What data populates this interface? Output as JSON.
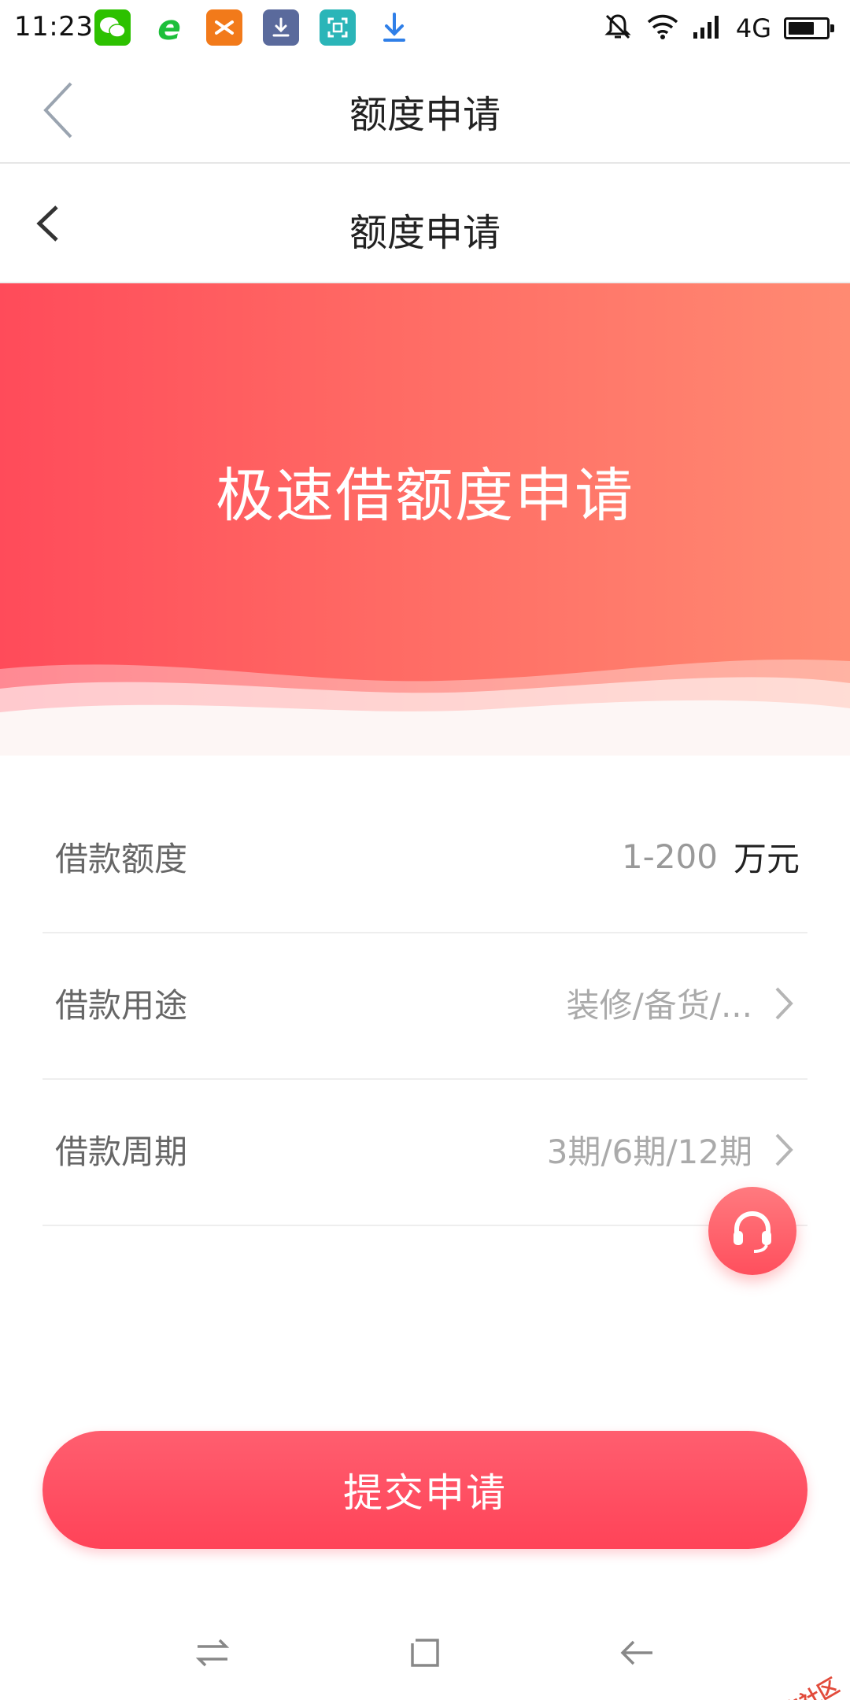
{
  "status_bar": {
    "time": "11:23",
    "network": "4G",
    "battery_level": 0.7,
    "app_icons": [
      "wechat-icon",
      "browser-icon",
      "app-orange-icon",
      "download-app-icon",
      "scanner-icon",
      "download-arrow-icon"
    ]
  },
  "outer_nav": {
    "title": "额度申请"
  },
  "inner_nav": {
    "title": "额度申请"
  },
  "banner": {
    "title": "极速借额度申请"
  },
  "form": {
    "rows": [
      {
        "label": "借款额度",
        "value": "1-200",
        "unit": "万元"
      },
      {
        "label": "借款用途",
        "value": "装修/备货/..."
      },
      {
        "label": "借款周期",
        "value": "3期/6期/12期"
      }
    ]
  },
  "submit": {
    "label": "提交申请"
  },
  "watermark": {
    "text": "卡农社区"
  },
  "colors": {
    "accent": "#ff4b5a",
    "banner_end": "#ff8a72",
    "muted_text": "#999999"
  }
}
